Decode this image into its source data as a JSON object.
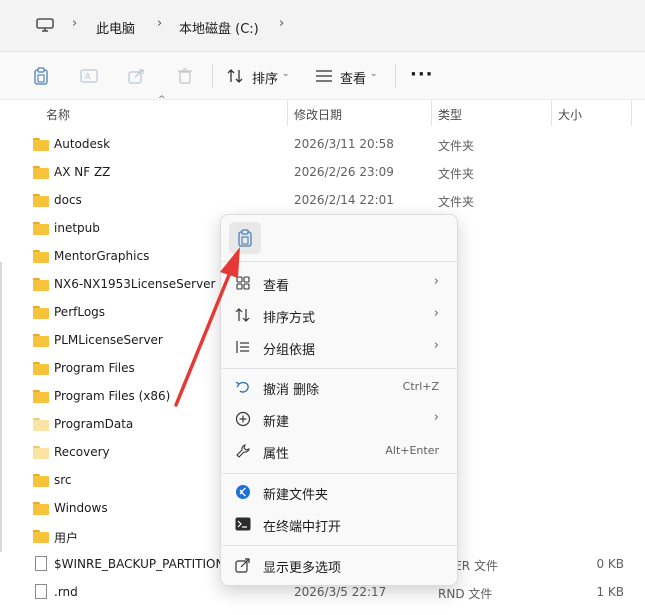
{
  "address": {
    "crumbs": [
      "此电脑",
      "本地磁盘 (C:)"
    ]
  },
  "toolbar": {
    "sort_label": "排序",
    "view_label": "查看",
    "more_label": "···"
  },
  "columns": {
    "name": "名称",
    "date": "修改日期",
    "type": "类型",
    "size": "大小"
  },
  "rows": [
    {
      "name": "Autodesk",
      "date": "2026/3/11 20:58",
      "type": "文件夹",
      "size": "",
      "icon": "folder-icon"
    },
    {
      "name": "AX NF ZZ",
      "date": "2026/2/26 23:09",
      "type": "文件夹",
      "size": "",
      "icon": "folder-icon"
    },
    {
      "name": "docs",
      "date": "2026/2/14 22:01",
      "type": "文件夹",
      "size": "",
      "icon": "folder-icon"
    },
    {
      "name": "inetpub",
      "date": "",
      "type": "",
      "size": "",
      "icon": "folder-icon"
    },
    {
      "name": "MentorGraphics",
      "date": "",
      "type": "",
      "size": "",
      "icon": "folder-icon"
    },
    {
      "name": "NX6-NX1953LicenseServer",
      "date": "",
      "type": "",
      "size": "",
      "icon": "folder-icon"
    },
    {
      "name": "PerfLogs",
      "date": "",
      "type": "",
      "size": "",
      "icon": "folder-icon"
    },
    {
      "name": "PLMLicenseServer",
      "date": "",
      "type": "",
      "size": "",
      "icon": "folder-icon"
    },
    {
      "name": "Program Files",
      "date": "",
      "type": "",
      "size": "",
      "icon": "folder-icon"
    },
    {
      "name": "Program Files (x86)",
      "date": "",
      "type": "",
      "size": "",
      "icon": "folder-icon"
    },
    {
      "name": "ProgramData",
      "date": "",
      "type": "",
      "size": "",
      "icon": "folder-light-icon"
    },
    {
      "name": "Recovery",
      "date": "",
      "type": "",
      "size": "",
      "icon": "folder-light-icon"
    },
    {
      "name": "src",
      "date": "",
      "type": "",
      "size": "",
      "icon": "folder-icon"
    },
    {
      "name": "Windows",
      "date": "",
      "type": "",
      "size": "",
      "icon": "folder-icon"
    },
    {
      "name": "用户",
      "date": "",
      "type": "",
      "size": "",
      "icon": "folder-icon"
    },
    {
      "name": "$WINRE_BACKUP_PARTITION",
      "date": "",
      "type": "RKER 文件",
      "size": "0 KB",
      "icon": "file-icon"
    },
    {
      "name": ".rnd",
      "date": "2026/3/5 22:17",
      "type": "RND 文件",
      "size": "1 KB",
      "icon": "file-icon"
    }
  ],
  "context_menu": {
    "paste_icon": "clipboard-icon",
    "items": [
      {
        "label": "查看",
        "accel": "",
        "submenu": true,
        "icon": "grid-icon"
      },
      {
        "label": "排序方式",
        "accel": "",
        "submenu": true,
        "icon": "sort-icon"
      },
      {
        "label": "分组依据",
        "accel": "",
        "submenu": true,
        "icon": "list-icon"
      },
      {
        "label": "撤消 删除",
        "accel": "Ctrl+Z",
        "submenu": false,
        "icon": "undo-icon"
      },
      {
        "label": "新建",
        "accel": "",
        "submenu": true,
        "icon": "plus-circle-icon"
      },
      {
        "label": "属性",
        "accel": "Alt+Enter",
        "submenu": false,
        "icon": "wrench-icon"
      },
      {
        "label": "新建文件夹",
        "accel": "",
        "submenu": false,
        "icon": "vscode-icon"
      },
      {
        "label": "在终端中打开",
        "accel": "",
        "submenu": false,
        "icon": "terminal-icon"
      },
      {
        "label": "显示更多选项",
        "accel": "",
        "submenu": false,
        "icon": "share-icon"
      }
    ]
  },
  "colors": {
    "accent_red": "#e53935",
    "folder": "#f8c33c"
  }
}
